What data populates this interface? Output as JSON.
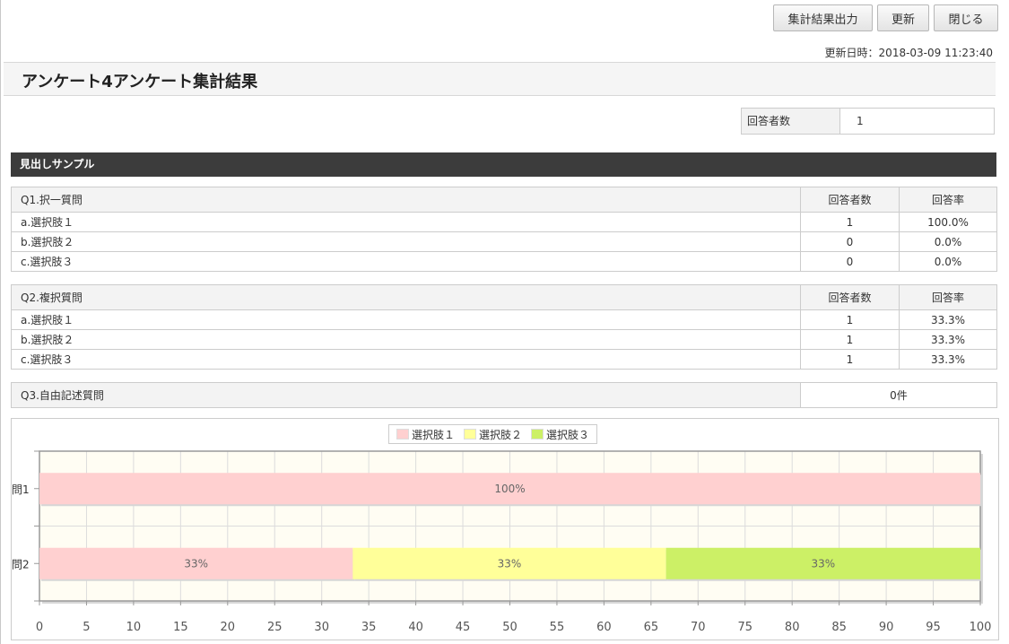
{
  "toolbar": {
    "export_label": "集計結果出力",
    "refresh_label": "更新",
    "close_label": "閉じる"
  },
  "updated_text": "更新日時：2018-03-09 11:23:40",
  "page_title": "アンケート4アンケート集計結果",
  "respondents": {
    "label": "回答者数",
    "value": "1"
  },
  "section_title": "見出しサンプル",
  "questions": [
    {
      "title": "Q1.択一質問",
      "count_header": "回答者数",
      "rate_header": "回答率",
      "options": [
        {
          "label": "a.選択肢１",
          "count": "1",
          "rate": "100.0%"
        },
        {
          "label": "b.選択肢２",
          "count": "0",
          "rate": "0.0%"
        },
        {
          "label": "c.選択肢３",
          "count": "0",
          "rate": "0.0%"
        }
      ]
    },
    {
      "title": "Q2.複択質問",
      "count_header": "回答者数",
      "rate_header": "回答率",
      "options": [
        {
          "label": "a.選択肢１",
          "count": "1",
          "rate": "33.3%"
        },
        {
          "label": "b.選択肢２",
          "count": "1",
          "rate": "33.3%"
        },
        {
          "label": "c.選択肢３",
          "count": "1",
          "rate": "33.3%"
        }
      ]
    },
    {
      "title": "Q3.自由記述質問",
      "value": "0件"
    }
  ],
  "colors": {
    "plot_bg": "#fffdf3",
    "grid": "#dcdcdc",
    "axis": "#999999",
    "series1": "#ffd0d0",
    "series2": "#ffff99",
    "series3": "#ccf066"
  },
  "chart_data": {
    "type": "bar",
    "orientation": "horizontal",
    "stacked": true,
    "categories": [
      "問1",
      "問2"
    ],
    "series": [
      {
        "name": "選択肢１",
        "values": [
          100,
          33.3
        ],
        "labels": [
          "100%",
          "33%"
        ]
      },
      {
        "name": "選択肢２",
        "values": [
          0,
          33.3
        ],
        "labels": [
          "",
          "33%"
        ]
      },
      {
        "name": "選択肢３",
        "values": [
          0,
          33.3
        ],
        "labels": [
          "",
          "33%"
        ]
      }
    ],
    "xlim": [
      0,
      100
    ],
    "xticks": [
      0,
      5,
      10,
      15,
      20,
      25,
      30,
      35,
      40,
      45,
      50,
      55,
      60,
      65,
      70,
      75,
      80,
      85,
      90,
      95,
      100
    ],
    "legend": "top-center",
    "grid": true
  }
}
